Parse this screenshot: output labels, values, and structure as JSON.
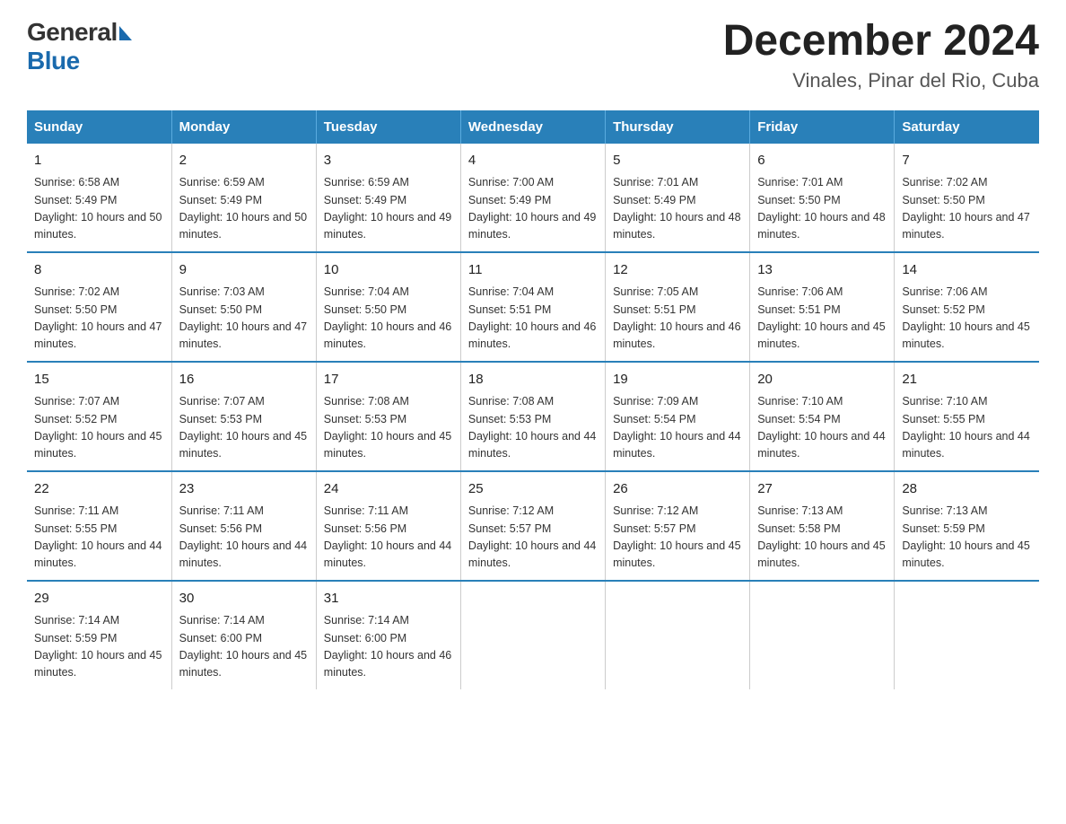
{
  "header": {
    "logo_general": "General",
    "logo_blue": "Blue",
    "main_title": "December 2024",
    "subtitle": "Vinales, Pinar del Rio, Cuba"
  },
  "calendar": {
    "days_of_week": [
      "Sunday",
      "Monday",
      "Tuesday",
      "Wednesday",
      "Thursday",
      "Friday",
      "Saturday"
    ],
    "weeks": [
      [
        {
          "day": "1",
          "sunrise": "Sunrise: 6:58 AM",
          "sunset": "Sunset: 5:49 PM",
          "daylight": "Daylight: 10 hours and 50 minutes."
        },
        {
          "day": "2",
          "sunrise": "Sunrise: 6:59 AM",
          "sunset": "Sunset: 5:49 PM",
          "daylight": "Daylight: 10 hours and 50 minutes."
        },
        {
          "day": "3",
          "sunrise": "Sunrise: 6:59 AM",
          "sunset": "Sunset: 5:49 PM",
          "daylight": "Daylight: 10 hours and 49 minutes."
        },
        {
          "day": "4",
          "sunrise": "Sunrise: 7:00 AM",
          "sunset": "Sunset: 5:49 PM",
          "daylight": "Daylight: 10 hours and 49 minutes."
        },
        {
          "day": "5",
          "sunrise": "Sunrise: 7:01 AM",
          "sunset": "Sunset: 5:49 PM",
          "daylight": "Daylight: 10 hours and 48 minutes."
        },
        {
          "day": "6",
          "sunrise": "Sunrise: 7:01 AM",
          "sunset": "Sunset: 5:50 PM",
          "daylight": "Daylight: 10 hours and 48 minutes."
        },
        {
          "day": "7",
          "sunrise": "Sunrise: 7:02 AM",
          "sunset": "Sunset: 5:50 PM",
          "daylight": "Daylight: 10 hours and 47 minutes."
        }
      ],
      [
        {
          "day": "8",
          "sunrise": "Sunrise: 7:02 AM",
          "sunset": "Sunset: 5:50 PM",
          "daylight": "Daylight: 10 hours and 47 minutes."
        },
        {
          "day": "9",
          "sunrise": "Sunrise: 7:03 AM",
          "sunset": "Sunset: 5:50 PM",
          "daylight": "Daylight: 10 hours and 47 minutes."
        },
        {
          "day": "10",
          "sunrise": "Sunrise: 7:04 AM",
          "sunset": "Sunset: 5:50 PM",
          "daylight": "Daylight: 10 hours and 46 minutes."
        },
        {
          "day": "11",
          "sunrise": "Sunrise: 7:04 AM",
          "sunset": "Sunset: 5:51 PM",
          "daylight": "Daylight: 10 hours and 46 minutes."
        },
        {
          "day": "12",
          "sunrise": "Sunrise: 7:05 AM",
          "sunset": "Sunset: 5:51 PM",
          "daylight": "Daylight: 10 hours and 46 minutes."
        },
        {
          "day": "13",
          "sunrise": "Sunrise: 7:06 AM",
          "sunset": "Sunset: 5:51 PM",
          "daylight": "Daylight: 10 hours and 45 minutes."
        },
        {
          "day": "14",
          "sunrise": "Sunrise: 7:06 AM",
          "sunset": "Sunset: 5:52 PM",
          "daylight": "Daylight: 10 hours and 45 minutes."
        }
      ],
      [
        {
          "day": "15",
          "sunrise": "Sunrise: 7:07 AM",
          "sunset": "Sunset: 5:52 PM",
          "daylight": "Daylight: 10 hours and 45 minutes."
        },
        {
          "day": "16",
          "sunrise": "Sunrise: 7:07 AM",
          "sunset": "Sunset: 5:53 PM",
          "daylight": "Daylight: 10 hours and 45 minutes."
        },
        {
          "day": "17",
          "sunrise": "Sunrise: 7:08 AM",
          "sunset": "Sunset: 5:53 PM",
          "daylight": "Daylight: 10 hours and 45 minutes."
        },
        {
          "day": "18",
          "sunrise": "Sunrise: 7:08 AM",
          "sunset": "Sunset: 5:53 PM",
          "daylight": "Daylight: 10 hours and 44 minutes."
        },
        {
          "day": "19",
          "sunrise": "Sunrise: 7:09 AM",
          "sunset": "Sunset: 5:54 PM",
          "daylight": "Daylight: 10 hours and 44 minutes."
        },
        {
          "day": "20",
          "sunrise": "Sunrise: 7:10 AM",
          "sunset": "Sunset: 5:54 PM",
          "daylight": "Daylight: 10 hours and 44 minutes."
        },
        {
          "day": "21",
          "sunrise": "Sunrise: 7:10 AM",
          "sunset": "Sunset: 5:55 PM",
          "daylight": "Daylight: 10 hours and 44 minutes."
        }
      ],
      [
        {
          "day": "22",
          "sunrise": "Sunrise: 7:11 AM",
          "sunset": "Sunset: 5:55 PM",
          "daylight": "Daylight: 10 hours and 44 minutes."
        },
        {
          "day": "23",
          "sunrise": "Sunrise: 7:11 AM",
          "sunset": "Sunset: 5:56 PM",
          "daylight": "Daylight: 10 hours and 44 minutes."
        },
        {
          "day": "24",
          "sunrise": "Sunrise: 7:11 AM",
          "sunset": "Sunset: 5:56 PM",
          "daylight": "Daylight: 10 hours and 44 minutes."
        },
        {
          "day": "25",
          "sunrise": "Sunrise: 7:12 AM",
          "sunset": "Sunset: 5:57 PM",
          "daylight": "Daylight: 10 hours and 44 minutes."
        },
        {
          "day": "26",
          "sunrise": "Sunrise: 7:12 AM",
          "sunset": "Sunset: 5:57 PM",
          "daylight": "Daylight: 10 hours and 45 minutes."
        },
        {
          "day": "27",
          "sunrise": "Sunrise: 7:13 AM",
          "sunset": "Sunset: 5:58 PM",
          "daylight": "Daylight: 10 hours and 45 minutes."
        },
        {
          "day": "28",
          "sunrise": "Sunrise: 7:13 AM",
          "sunset": "Sunset: 5:59 PM",
          "daylight": "Daylight: 10 hours and 45 minutes."
        }
      ],
      [
        {
          "day": "29",
          "sunrise": "Sunrise: 7:14 AM",
          "sunset": "Sunset: 5:59 PM",
          "daylight": "Daylight: 10 hours and 45 minutes."
        },
        {
          "day": "30",
          "sunrise": "Sunrise: 7:14 AM",
          "sunset": "Sunset: 6:00 PM",
          "daylight": "Daylight: 10 hours and 45 minutes."
        },
        {
          "day": "31",
          "sunrise": "Sunrise: 7:14 AM",
          "sunset": "Sunset: 6:00 PM",
          "daylight": "Daylight: 10 hours and 46 minutes."
        },
        {
          "day": "",
          "sunrise": "",
          "sunset": "",
          "daylight": ""
        },
        {
          "day": "",
          "sunrise": "",
          "sunset": "",
          "daylight": ""
        },
        {
          "day": "",
          "sunrise": "",
          "sunset": "",
          "daylight": ""
        },
        {
          "day": "",
          "sunrise": "",
          "sunset": "",
          "daylight": ""
        }
      ]
    ]
  }
}
